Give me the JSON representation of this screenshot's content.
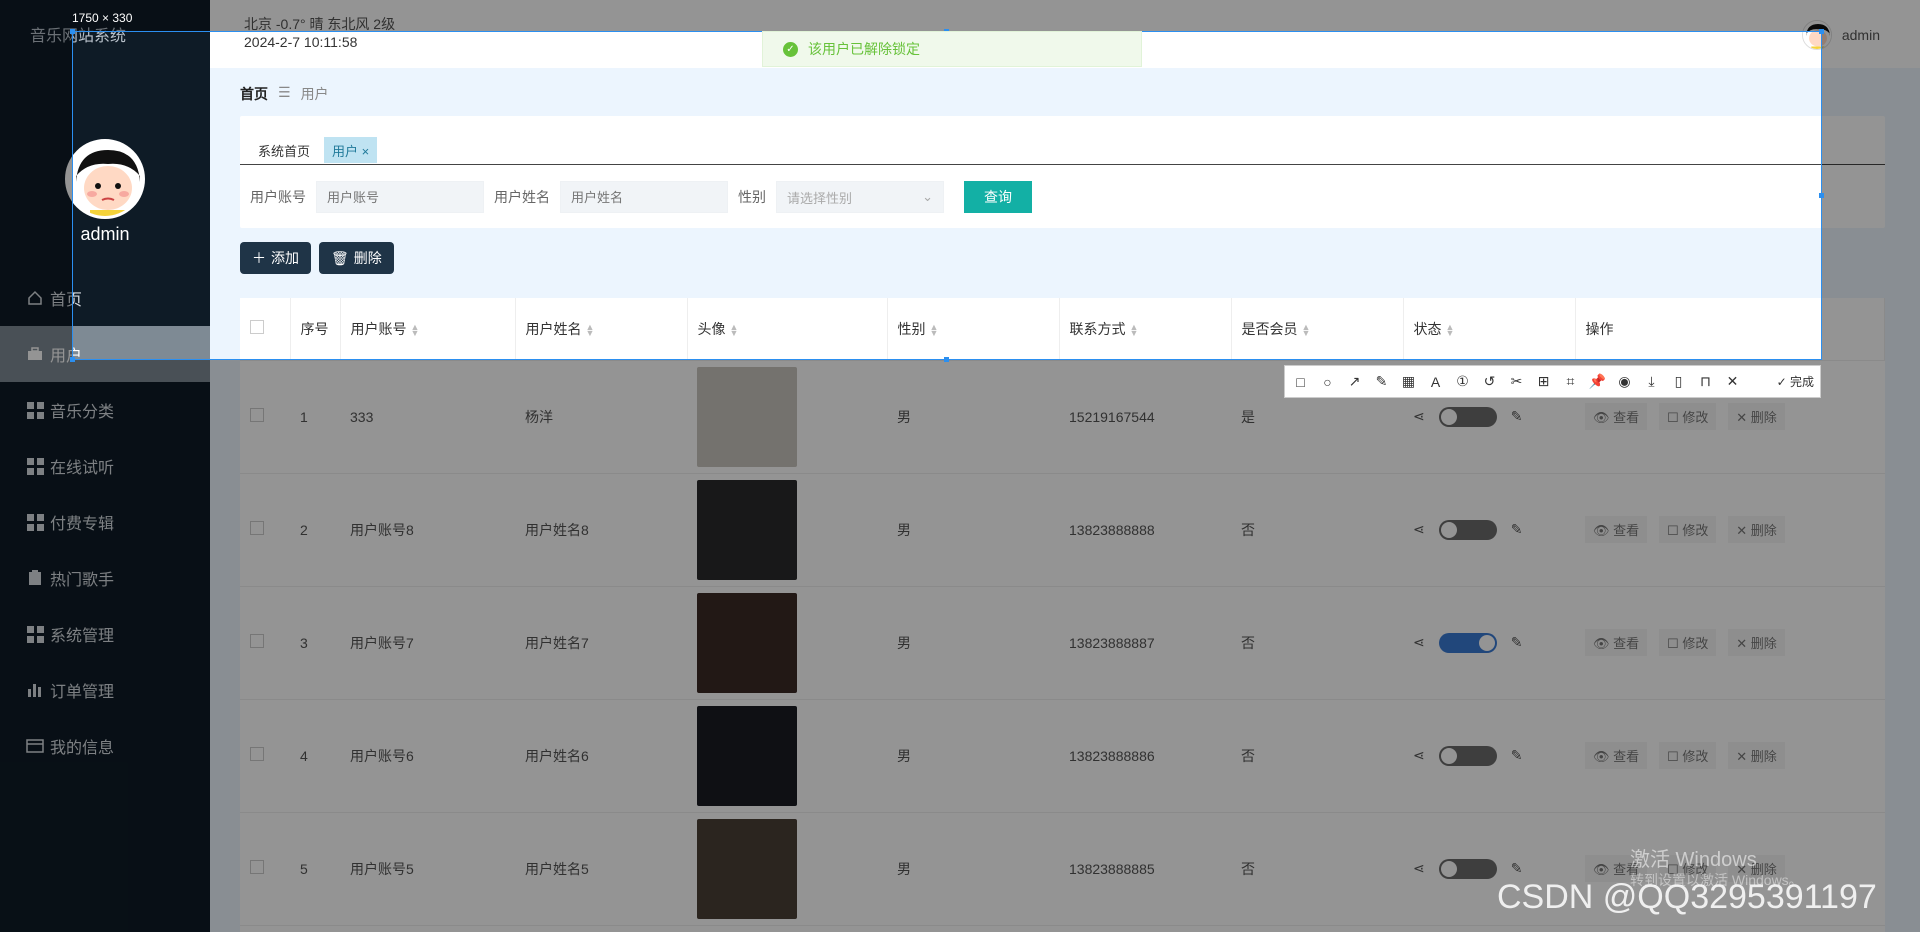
{
  "app": {
    "brand": "音乐网站系统",
    "user": "admin"
  },
  "topbar": {
    "weather": "北京  -0.7°  晴  东北风  2级",
    "datetime": "2024-2-7 10:11:58",
    "user": "admin"
  },
  "sidebar": {
    "items": [
      {
        "label": "首页",
        "icon": "home-icon"
      },
      {
        "label": "用户",
        "icon": "briefcase-icon",
        "active": true
      },
      {
        "label": "音乐分类",
        "icon": "grid-icon"
      },
      {
        "label": "在线试听",
        "icon": "grid-icon"
      },
      {
        "label": "付费专辑",
        "icon": "grid-icon"
      },
      {
        "label": "热门歌手",
        "icon": "clipboard-icon"
      },
      {
        "label": "系统管理",
        "icon": "grid-icon"
      },
      {
        "label": "订单管理",
        "icon": "bar-chart-icon"
      },
      {
        "label": "我的信息",
        "icon": "id-card-icon"
      }
    ]
  },
  "breadcrumb": {
    "home": "首页",
    "sep": "☰",
    "current": "用户"
  },
  "tabs": [
    {
      "label": "系统首页"
    },
    {
      "label": "用户 ×",
      "active": true
    }
  ],
  "search": {
    "account_label": "用户账号",
    "account_placeholder": "用户账号",
    "name_label": "用户姓名",
    "name_placeholder": "用户姓名",
    "gender_label": "性别",
    "gender_placeholder": "请选择性别",
    "query": "查询"
  },
  "actions": {
    "add": "添加",
    "delete": "删除"
  },
  "table": {
    "headers": [
      "序号",
      "用户账号",
      "用户姓名",
      "头像",
      "性别",
      "联系方式",
      "是否会员",
      "状态",
      "操作"
    ],
    "rows": [
      {
        "idx": "1",
        "account": "333",
        "name": "杨洋",
        "gender": "男",
        "phone": "15219167544",
        "member": "是",
        "on": false,
        "photo": "#c9c4bd"
      },
      {
        "idx": "2",
        "account": "用户账号8",
        "name": "用户姓名8",
        "gender": "男",
        "phone": "13823888888",
        "member": "否",
        "on": false,
        "photo": "#2a2a2c"
      },
      {
        "idx": "3",
        "account": "用户账号7",
        "name": "用户姓名7",
        "gender": "男",
        "phone": "13823888887",
        "member": "否",
        "on": true,
        "photo": "#3b2a25"
      },
      {
        "idx": "4",
        "account": "用户账号6",
        "name": "用户姓名6",
        "gender": "男",
        "phone": "13823888886",
        "member": "否",
        "on": false,
        "photo": "#1b1c24"
      },
      {
        "idx": "5",
        "account": "用户账号5",
        "name": "用户姓名5",
        "gender": "男",
        "phone": "13823888885",
        "member": "否",
        "on": false,
        "photo": "#4a4036"
      }
    ],
    "ops": {
      "view": "查看",
      "edit": "修改",
      "del": "删除"
    }
  },
  "overlay": {
    "size_label": "1750 × 330",
    "toast": "该用户已解除锁定",
    "toolbar_done": "完成",
    "watermark": "激活 Windows",
    "watermark_sub": "转到设置以激活 Windows。",
    "csdn": "CSDN @QQ3295391197"
  }
}
